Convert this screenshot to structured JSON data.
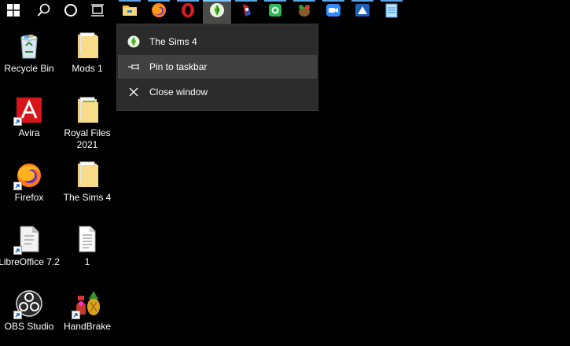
{
  "taskbar": {
    "start": {
      "icon": "windows-start-icon"
    },
    "search": {
      "icon": "search-icon"
    },
    "cortana": {
      "icon": "cortana-circle-icon"
    },
    "taskview": {
      "icon": "task-view-icon"
    },
    "apps": [
      {
        "name": "file-explorer",
        "icon": "folder-icon",
        "active": false
      },
      {
        "name": "firefox",
        "icon": "firefox-icon",
        "active": false
      },
      {
        "name": "opera",
        "icon": "opera-icon",
        "active": false
      },
      {
        "name": "the-sims-4",
        "icon": "sims-plumbob-icon",
        "active": true
      },
      {
        "name": "app-5",
        "icon": "red-blue-app-icon",
        "active": false
      },
      {
        "name": "app-6",
        "icon": "green-app-icon",
        "active": false
      },
      {
        "name": "app-7",
        "icon": "creature-app-icon",
        "active": false
      },
      {
        "name": "zoom",
        "icon": "video-camera-icon",
        "active": false
      },
      {
        "name": "app-9",
        "icon": "blue-triangle-app-icon",
        "active": false
      },
      {
        "name": "notepad",
        "icon": "notepad-icon",
        "active": false
      }
    ]
  },
  "context_menu": {
    "items": [
      {
        "label": "The Sims 4",
        "icon": "sims-plumbob-icon"
      },
      {
        "label": "Pin to taskbar",
        "icon": "pin-icon"
      },
      {
        "label": "Close window",
        "icon": "close-icon"
      }
    ]
  },
  "desktop": {
    "icons": [
      {
        "label": "Recycle Bin",
        "icon": "recycle-bin-icon"
      },
      {
        "label": "Mods 1",
        "icon": "folder-icon"
      },
      {
        "label": "Avira",
        "icon": "avira-icon"
      },
      {
        "label": "Royal Files 2021",
        "icon": "folder-icon"
      },
      {
        "label": "Firefox",
        "icon": "firefox-icon"
      },
      {
        "label": "The Sims 4",
        "icon": "folder-icon"
      },
      {
        "label": "LibreOffice 7.2",
        "icon": "libreoffice-icon"
      },
      {
        "label": "1",
        "icon": "text-document-icon"
      },
      {
        "label": "OBS Studio",
        "icon": "obs-studio-icon"
      },
      {
        "label": "HandBrake",
        "icon": "handbrake-icon"
      }
    ]
  },
  "colors": {
    "taskbar_bg": "#000000",
    "menu_bg": "#2b2b2b",
    "menu_hover": "#414141",
    "indicator": "#5aa6e6"
  }
}
